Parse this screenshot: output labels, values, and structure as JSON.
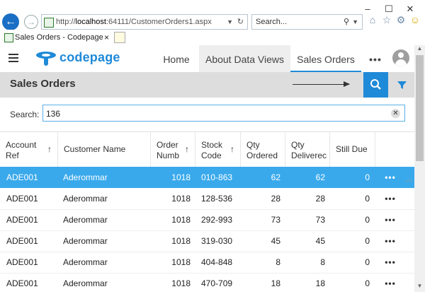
{
  "browser": {
    "url_prefix": "http://",
    "url_host": "localhost",
    "url_rest": ":64111/CustomerOrders1.aspx",
    "search_placeholder": "Search...",
    "tab_title": "Sales Orders - Codepage",
    "tab_close": "×",
    "window": {
      "minimize": "–",
      "maximize": "☐",
      "close": "✕"
    }
  },
  "app": {
    "brand": "codepage",
    "nav": {
      "home": "Home",
      "about": "About Data Views",
      "sales": "Sales Orders",
      "more": "•••"
    }
  },
  "page": {
    "title": "Sales Orders",
    "search_label": "Search:",
    "search_value": "136",
    "clear": "✕"
  },
  "table": {
    "headers": {
      "account_ref": [
        "Account",
        "Ref"
      ],
      "customer_name": "Customer Name",
      "order_numb": [
        "Order",
        "Numb"
      ],
      "stock_code": [
        "Stock",
        "Code"
      ],
      "qty_ordered": [
        "Qty",
        "Ordered"
      ],
      "qty_delivered": [
        "Qty",
        "Deliverec"
      ],
      "still_due": "Still Due",
      "sort_glyph": "↑"
    },
    "rows": [
      {
        "account": "ADE001",
        "customer": "Aderommar",
        "order": "1018",
        "stock": "010-863",
        "ordered": "62",
        "delivered": "62",
        "due": "0",
        "more": "•••"
      },
      {
        "account": "ADE001",
        "customer": "Aderommar",
        "order": "1018",
        "stock": "128-536",
        "ordered": "28",
        "delivered": "28",
        "due": "0",
        "more": "•••"
      },
      {
        "account": "ADE001",
        "customer": "Aderommar",
        "order": "1018",
        "stock": "292-993",
        "ordered": "73",
        "delivered": "73",
        "due": "0",
        "more": "•••"
      },
      {
        "account": "ADE001",
        "customer": "Aderommar",
        "order": "1018",
        "stock": "319-030",
        "ordered": "45",
        "delivered": "45",
        "due": "0",
        "more": "•••"
      },
      {
        "account": "ADE001",
        "customer": "Aderommar",
        "order": "1018",
        "stock": "404-848",
        "ordered": "8",
        "delivered": "8",
        "due": "0",
        "more": "•••"
      },
      {
        "account": "ADE001",
        "customer": "Aderommar",
        "order": "1018",
        "stock": "470-709",
        "ordered": "18",
        "delivered": "18",
        "due": "0",
        "more": "•••"
      }
    ]
  },
  "colors": {
    "accent": "#1f8ad8",
    "selected_row": "#39a9ec",
    "titlebar": "#dddddd"
  }
}
